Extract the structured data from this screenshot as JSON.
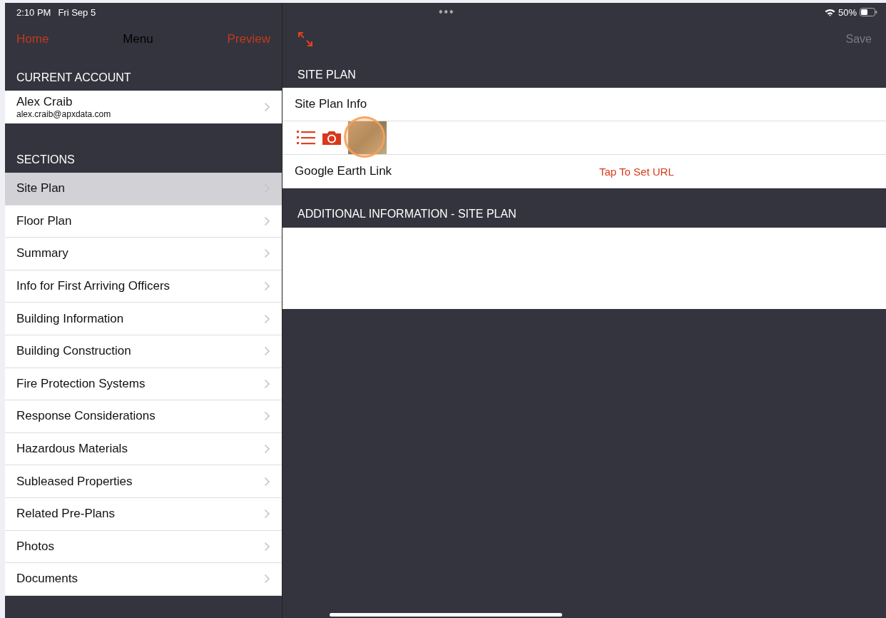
{
  "status_bar": {
    "time": "2:10 PM",
    "date": "Fri Sep 5",
    "battery": "50%"
  },
  "sidebar": {
    "nav": {
      "left": "Home",
      "title": "Menu",
      "right": "Preview"
    },
    "account_header": "CURRENT ACCOUNT",
    "account": {
      "name": "Alex Craib",
      "email": "alex.craib@apxdata.com"
    },
    "sections_header": "SECTIONS",
    "items": [
      {
        "label": "Site Plan",
        "selected": true
      },
      {
        "label": "Floor Plan",
        "selected": false
      },
      {
        "label": "Summary",
        "selected": false
      },
      {
        "label": "Info for First Arriving Officers",
        "selected": false
      },
      {
        "label": "Building Information",
        "selected": false
      },
      {
        "label": "Building Construction",
        "selected": false
      },
      {
        "label": "Fire Protection Systems",
        "selected": false
      },
      {
        "label": "Response Considerations",
        "selected": false
      },
      {
        "label": "Hazardous Materials",
        "selected": false
      },
      {
        "label": "Subleased Properties",
        "selected": false
      },
      {
        "label": "Related Pre-Plans",
        "selected": false
      },
      {
        "label": "Photos",
        "selected": false
      },
      {
        "label": "Documents",
        "selected": false
      }
    ]
  },
  "detail": {
    "save": "Save",
    "section_header": "SITE PLAN",
    "info_label": "Site Plan Info",
    "link_label": "Google Earth Link",
    "link_value": "Tap To Set URL",
    "additional_header": "ADDITIONAL INFORMATION - SITE PLAN"
  }
}
